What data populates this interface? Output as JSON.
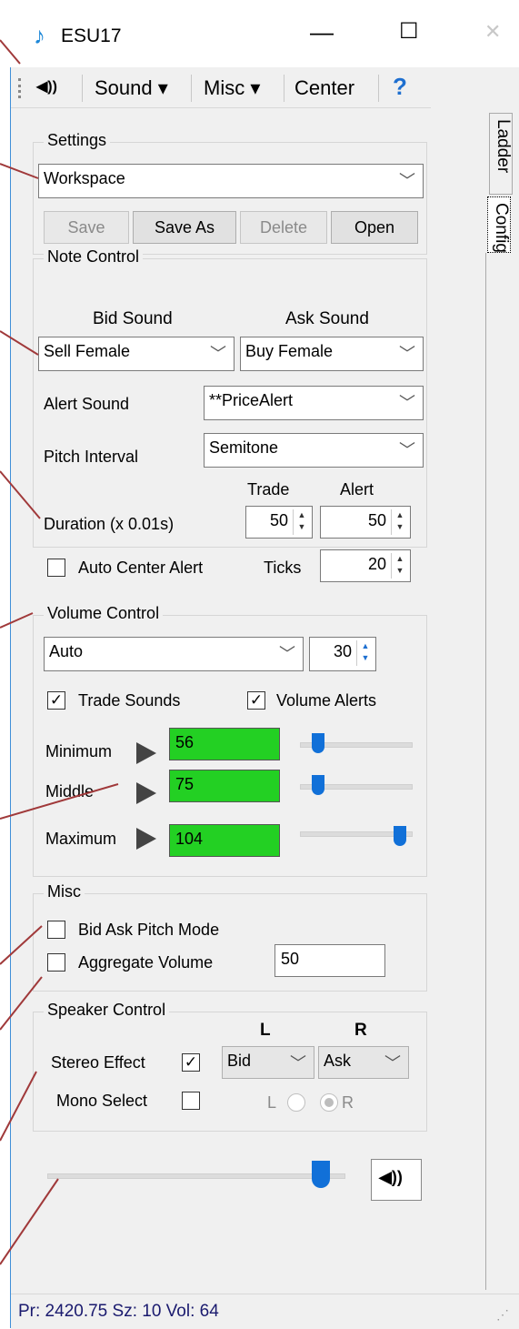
{
  "window": {
    "title": "ESU17",
    "minimize": "—",
    "maximize": "☐",
    "close": "✕"
  },
  "toolbar": {
    "speaker": "◀︎))",
    "sound": "Sound ▾",
    "misc": "Misc ▾",
    "center": "Center",
    "help": "?"
  },
  "tabs": [
    {
      "label": "Ladder"
    },
    {
      "label": "Config"
    }
  ],
  "settings": {
    "title": "Settings",
    "workspace": "Workspace",
    "save": "Save",
    "save_as": "Save As",
    "delete": "Delete",
    "open": "Open"
  },
  "note_control": {
    "title": "Note Control",
    "bid_sound_label": "Bid Sound",
    "ask_sound_label": "Ask Sound",
    "bid_sound": "Sell Female",
    "ask_sound": "Buy Female",
    "alert_sound_label": "Alert Sound",
    "alert_sound": "**PriceAlert",
    "pitch_interval_label": "Pitch Interval",
    "pitch_interval": "Semitone",
    "trade_label": "Trade",
    "alert_label": "Alert",
    "duration_label": "Duration (x 0.01s)",
    "duration_trade": "50",
    "duration_alert": "50",
    "auto_center_alert": "Auto Center Alert",
    "ticks_label": "Ticks",
    "ticks": "20"
  },
  "volume_control": {
    "title": "Volume Control",
    "mode": "Auto",
    "mode_value": "30",
    "trade_sounds": "Trade Sounds",
    "volume_alerts": "Volume Alerts",
    "minimum_label": "Minimum",
    "minimum": "56",
    "minimum_level": 0.12,
    "middle_label": "Middle",
    "middle": "75",
    "middle_level": 0.12,
    "maximum_label": "Maximum",
    "maximum": "104",
    "maximum_level": 0.95
  },
  "misc": {
    "title": "Misc",
    "bid_ask_pitch": "Bid Ask Pitch Mode",
    "aggregate_volume": "Aggregate Volume",
    "aggregate_value": "50"
  },
  "speaker_control": {
    "title": "Speaker Control",
    "l_header": "L",
    "r_header": "R",
    "stereo_effect": "Stereo Effect",
    "left_channel": "Bid",
    "right_channel": "Ask",
    "mono_select": "Mono Select",
    "radio_l": "L",
    "radio_r": "R"
  },
  "master_volume_level": 0.95,
  "status": "Pr: 2420.75  Sz: 10  Vol: 64",
  "colors": {
    "accent": "#1170d8",
    "green": "#23d023",
    "pointer": "#a0393a"
  }
}
